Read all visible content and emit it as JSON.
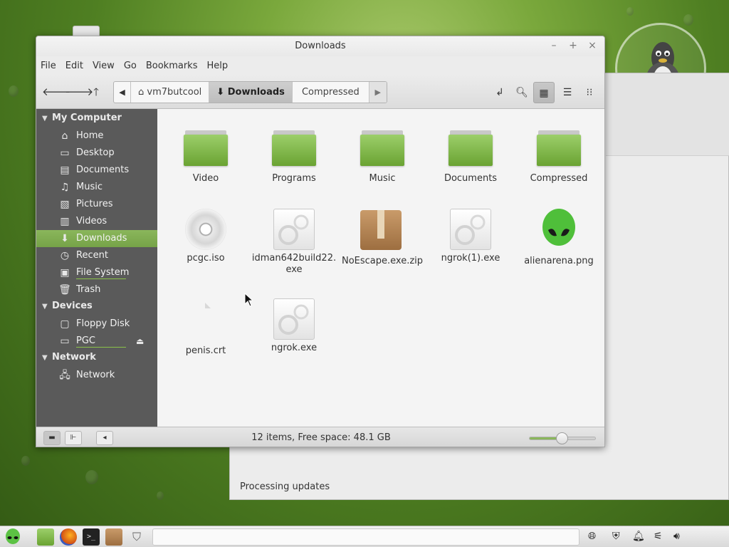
{
  "window": {
    "title": "Downloads",
    "buttons": {
      "minimize": "–",
      "maximize": "+",
      "close": "×"
    }
  },
  "menu": [
    "File",
    "Edit",
    "View",
    "Go",
    "Bookmarks",
    "Help"
  ],
  "toolbar": {
    "pathbar": [
      "vm7butcool",
      "Downloads",
      "Compressed"
    ],
    "active_path_index": 1
  },
  "sidebar": {
    "sections": [
      {
        "title": "My Computer",
        "items": [
          {
            "label": "Home",
            "icon": "home-icon"
          },
          {
            "label": "Desktop",
            "icon": "desktop-icon"
          },
          {
            "label": "Documents",
            "icon": "documents-icon"
          },
          {
            "label": "Music",
            "icon": "music-icon"
          },
          {
            "label": "Pictures",
            "icon": "pictures-icon"
          },
          {
            "label": "Videos",
            "icon": "videos-icon"
          },
          {
            "label": "Downloads",
            "icon": "downloads-icon",
            "selected": true
          },
          {
            "label": "Recent",
            "icon": "recent-icon"
          },
          {
            "label": "File System",
            "icon": "filesystem-icon"
          },
          {
            "label": "Trash",
            "icon": "trash-icon"
          }
        ]
      },
      {
        "title": "Devices",
        "items": [
          {
            "label": "Floppy Disk",
            "icon": "floppy-icon"
          },
          {
            "label": "PGC",
            "icon": "drive-icon"
          }
        ]
      },
      {
        "title": "Network",
        "items": [
          {
            "label": "Network",
            "icon": "network-icon"
          }
        ]
      }
    ]
  },
  "files": [
    {
      "name": "Video",
      "type": "folder"
    },
    {
      "name": "Programs",
      "type": "folder"
    },
    {
      "name": "Music",
      "type": "folder"
    },
    {
      "name": "Documents",
      "type": "folder"
    },
    {
      "name": "Compressed",
      "type": "folder"
    },
    {
      "name": "pcgc.iso",
      "type": "disc"
    },
    {
      "name": "idman642build22.exe",
      "type": "executable"
    },
    {
      "name": "NoEscape.exe.zip",
      "type": "archive"
    },
    {
      "name": "ngrok(1).exe",
      "type": "executable"
    },
    {
      "name": "alienarena.png",
      "type": "image"
    },
    {
      "name": "penis.crt",
      "type": "certificate"
    },
    {
      "name": "ngrok.exe",
      "type": "executable"
    }
  ],
  "statusbar": {
    "text": "12 items, Free space: 48.1 GB",
    "zoom_level": 0.5
  },
  "background_window": {
    "status": "Processing updates"
  },
  "colors": {
    "accent": "#7fae50",
    "sidebar_bg": "#5a5a5a",
    "folder_green": "#7cb544"
  }
}
